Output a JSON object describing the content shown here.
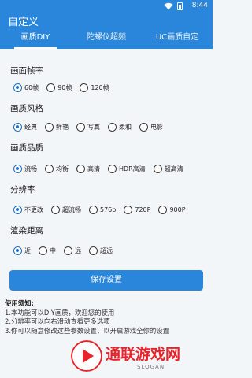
{
  "status": {
    "time": "8:44"
  },
  "app": {
    "title": "自定义"
  },
  "tabs": [
    {
      "label": "画质DIY"
    },
    {
      "label": "陀螺仪超频"
    },
    {
      "label": "UC画质自定"
    }
  ],
  "sections": {
    "fps": {
      "title": "画面帧率",
      "options": [
        "60帧",
        "90帧",
        "120帧"
      ],
      "selected": "60帧"
    },
    "style": {
      "title": "画质风格",
      "options": [
        "经典",
        "鲜艳",
        "写真",
        "柔和",
        "电影"
      ],
      "selected": "经典"
    },
    "quality": {
      "title": "画质品质",
      "options": [
        "流畅",
        "均衡",
        "高清",
        "HDR高清",
        "超高清"
      ],
      "selected": "流畅"
    },
    "resolution": {
      "title": "分辨率",
      "options": [
        "不更改",
        "超流畅",
        "576p",
        "720P",
        "900P"
      ],
      "selected": "不更改"
    },
    "distance": {
      "title": "渲染距离",
      "options": [
        "近",
        "中",
        "远",
        "超远"
      ],
      "selected": "近"
    }
  },
  "save_button": "保存设置",
  "notes": {
    "title": "使用须知:",
    "lines": [
      "1.本功能可以DIY画质，欢迎您的使用",
      "2.分辨率可以向右滑动查看更多选项",
      "3.你可以随意修改这些参数设置，以开启游戏全你的设置"
    ]
  },
  "watermark": {
    "text": "通联游戏网",
    "slogan": "SLOGAN"
  },
  "colors": {
    "primary": "#2a86db",
    "radio_checked": "#1b6fc4",
    "watermark_red": "#e8232a"
  }
}
